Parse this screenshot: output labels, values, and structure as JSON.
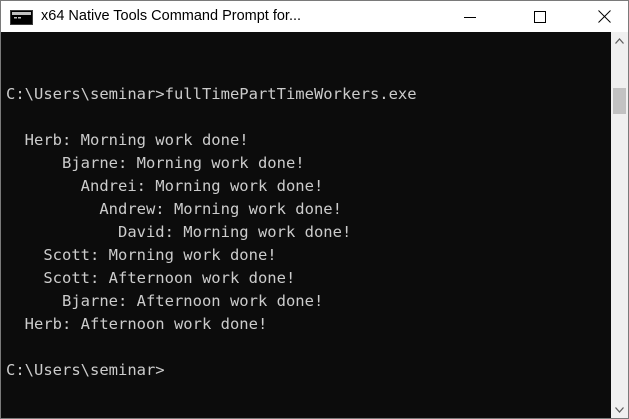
{
  "window": {
    "title": "x64 Native Tools Command Prompt for...",
    "icon": "cmd-icon"
  },
  "caption_buttons": {
    "minimize": "minimize-icon",
    "maximize": "maximize-icon",
    "close": "close-icon"
  },
  "console": {
    "lines": [
      "",
      "C:\\Users\\seminar>fullTimePartTimeWorkers.exe",
      "",
      "  Herb: Morning work done!",
      "      Bjarne: Morning work done!",
      "        Andrei: Morning work done!",
      "          Andrew: Morning work done!",
      "            David: Morning work done!",
      "    Scott: Morning work done!",
      "    Scott: Afternoon work done!",
      "      Bjarne: Afternoon work done!",
      "  Herb: Afternoon work done!",
      "",
      "C:\\Users\\seminar>"
    ]
  },
  "colors": {
    "console_background": "#0c0c0c",
    "console_text": "#cccccc",
    "titlebar_background": "#ffffff"
  }
}
